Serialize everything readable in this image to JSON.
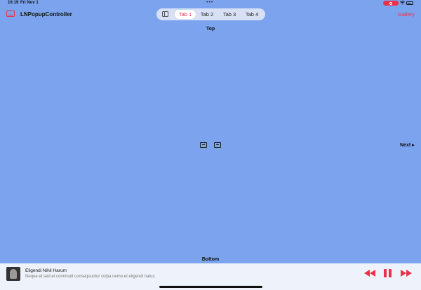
{
  "status": {
    "time": "16:19",
    "date": "Fri Nov 1",
    "dots": "•••"
  },
  "nav": {
    "title": "LNPopupController",
    "gallery_label": "Gallery",
    "tabs": [
      {
        "label": "Tab 1",
        "active": true
      },
      {
        "label": "Tab 2",
        "active": false
      },
      {
        "label": "Tab 3",
        "active": false
      },
      {
        "label": "Tab 4",
        "active": false
      }
    ]
  },
  "content": {
    "top_label": "Top",
    "bottom_label": "Bottom",
    "next_label": "Next ▸"
  },
  "popup": {
    "title": "Eligendi Nihil Harum",
    "subtitle": "Neque et sed et commodi consequuntur culpa nemo et eligendi natus"
  },
  "colors": {
    "background": "#7BA3EE",
    "accent": "#E8324A",
    "popup_bg": "#EEF3FB"
  },
  "icons": [
    "sidebar-icon",
    "image-icon",
    "rewind-icon",
    "pause-icon",
    "forward-icon",
    "wifi-icon",
    "battery-icon",
    "record-icon"
  ]
}
